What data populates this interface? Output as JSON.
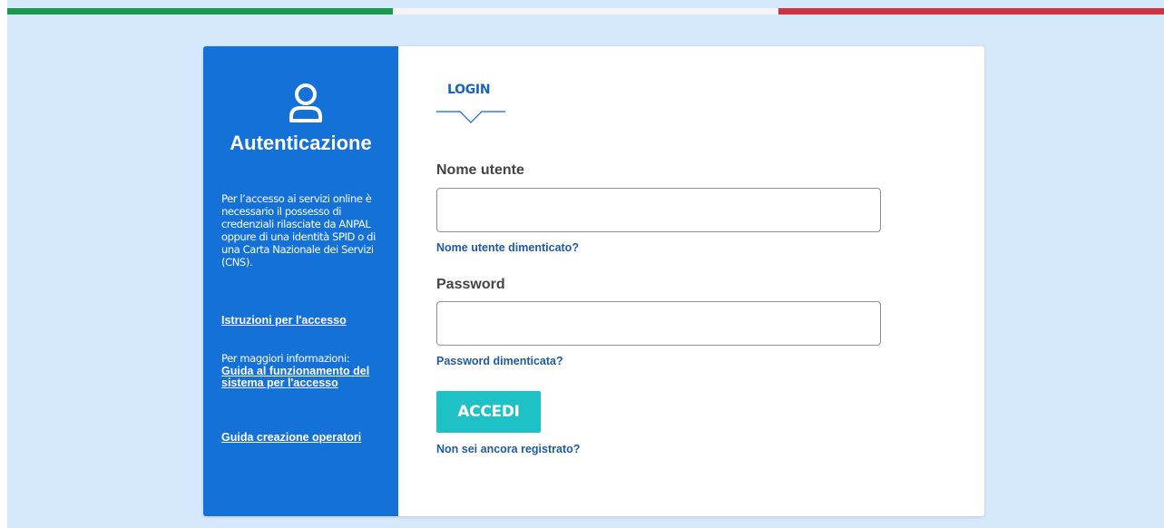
{
  "colors": {
    "flag_green": "#1a9a4b",
    "flag_white": "#f4f4f4",
    "flag_red": "#d0333d",
    "sidebar_bg": "#1471d8",
    "accent_blue": "#1565c0",
    "button_teal": "#1ec2c6",
    "page_bg": "#d6e8fb"
  },
  "sidebar": {
    "icon": "user-icon",
    "title": "Autenticazione",
    "description": "Per l’accesso ai servizi online è necessario il possesso di credenziali rilasciate da ANPAL oppure di una identità SPID o di una Carta Nazionale dei Servizi (CNS).",
    "instructions_link": "Istruzioni per l'accesso",
    "more_info_label": "Per maggiori informazioni:",
    "guide_link": "Guida al funzionamento del sistema per l'accesso",
    "operators_link": "Guida creazione operatori"
  },
  "login": {
    "tab_label": "LOGIN",
    "username_label": "Nome utente",
    "username_value": "",
    "username_forgot": "Nome utente dimenticato?",
    "password_label": "Password",
    "password_value": "",
    "password_forgot": "Password dimenticata?",
    "submit_label": "ACCEDI",
    "register_link": "Non sei ancora registrato?"
  }
}
